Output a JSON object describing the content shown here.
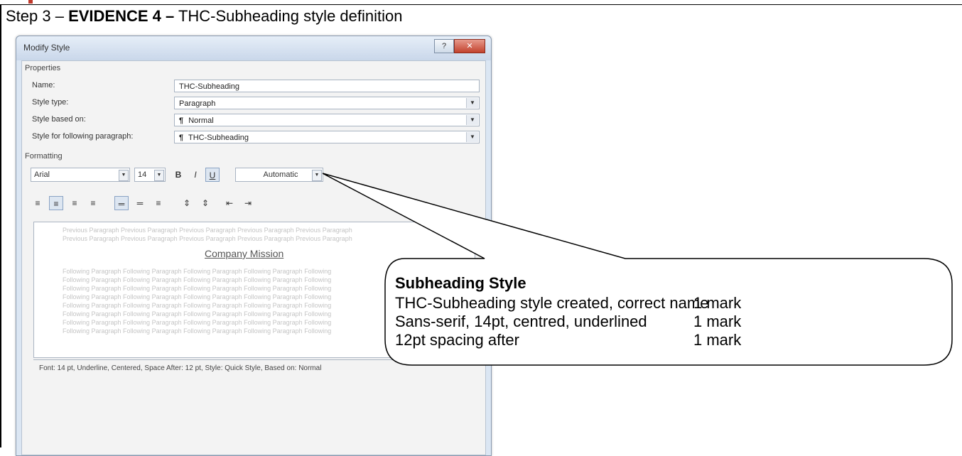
{
  "heading": {
    "prefix": "Step 3 –",
    "evidence": "EVIDENCE 4 –",
    "suffix": "THC-Subheading style definition"
  },
  "dialog": {
    "title": "Modify Style",
    "properties_label": "Properties",
    "fields": [
      {
        "label": "Name:",
        "value": "THC-Subheading"
      },
      {
        "label": "Style type:",
        "value": "Paragraph"
      },
      {
        "label": "Style based on:",
        "value": "Normal"
      },
      {
        "label": "Style for following paragraph:",
        "value": "THC-Subheading"
      }
    ],
    "formatting_label": "Formatting",
    "font": "Arial",
    "size": "14",
    "bold": "B",
    "italic": "I",
    "underline": "U",
    "color": "Automatic",
    "preview_previous": "Previous Paragraph Previous Paragraph Previous Paragraph Previous Paragraph Previous Paragraph",
    "preview_sample": "Company Mission",
    "preview_following": "Following Paragraph Following Paragraph Following Paragraph Following Paragraph Following",
    "description": "Font: 14 pt, Underline, Centered, Space After:  12 pt, Style: Quick Style, Based on: Normal"
  },
  "callout": {
    "title": "Subheading Style",
    "criteria": [
      {
        "label": "THC-Subheading style created, correct name",
        "mark": "1 mark"
      },
      {
        "label": "Sans-serif, 14pt, centred, underlined",
        "mark": "1 mark"
      },
      {
        "label": "12pt spacing after",
        "mark": "1 mark"
      }
    ]
  },
  "icons": {
    "paragraph": "¶",
    "dropdown": "▼"
  }
}
